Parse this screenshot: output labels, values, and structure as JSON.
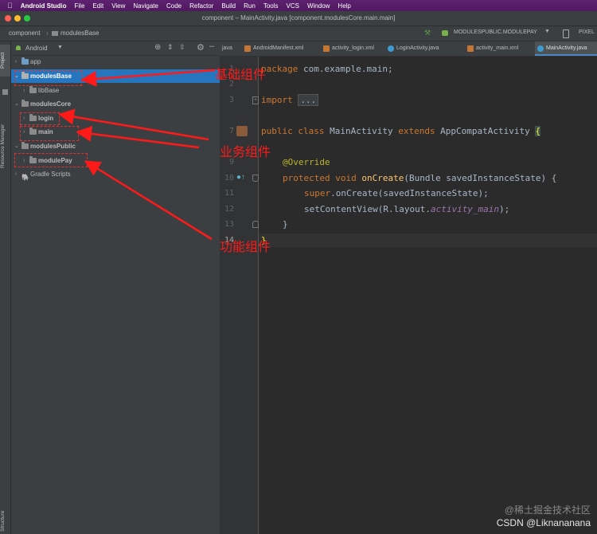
{
  "menubar": {
    "items": [
      "Android Studio",
      "File",
      "Edit",
      "View",
      "Navigate",
      "Code",
      "Refactor",
      "Build",
      "Run",
      "Tools",
      "VCS",
      "Window",
      "Help"
    ]
  },
  "titlebar": {
    "title": "component – MainActivity.java [component.modulesCore.main.main]"
  },
  "navbar": {
    "crumb1": "component",
    "crumb2": "modulesBase",
    "run_config": "MODULESPUBLIC.MODULEPAY",
    "device": "PIXEL"
  },
  "toolstrip": {
    "project": "Project",
    "resource_manager": "Resource Manager",
    "structure": "Structure"
  },
  "project_panel": {
    "view_mode": "Android",
    "tree": [
      {
        "label": "app",
        "expanded": false
      },
      {
        "label": "modulesBase",
        "expanded": true,
        "selected": true
      },
      {
        "label": "libBase",
        "expanded": false
      },
      {
        "label": "modulesCore",
        "expanded": true
      },
      {
        "label": "login",
        "expanded": false
      },
      {
        "label": "main",
        "expanded": false
      },
      {
        "label": "modulesPublic",
        "expanded": true
      },
      {
        "label": "modulePay",
        "expanded": false
      },
      {
        "label": "Gradle Scripts",
        "expanded": false
      }
    ]
  },
  "tabs": [
    {
      "label": "java"
    },
    {
      "label": "AndroidManifest.xml"
    },
    {
      "label": "activity_login.xml"
    },
    {
      "label": "LoginActivity.java"
    },
    {
      "label": "activity_main.xml"
    },
    {
      "label": "MainActivity.java",
      "active": true
    }
  ],
  "editor": {
    "line_numbers": [
      "1",
      "2",
      "3",
      "7",
      "9",
      "10",
      "11",
      "12",
      "13",
      "14"
    ],
    "code": {
      "l1_kw": "package",
      "l1_rest": " com.example.main;",
      "l3_kw": "import",
      "l3_fold": "...",
      "l7_kw1": "public class",
      "l7_name": " MainActivity ",
      "l7_kw2": "extends",
      "l7_rest": " AppCompatActivity ",
      "l7_brace": "{",
      "l9_ann": "@Override",
      "l10_kw": "protected void",
      "l10_fn": " onCreate",
      "l10_rest": "(Bundle savedInstanceState) {",
      "l11_kw": "super",
      "l11_rest": ".onCreate(savedInstanceState);",
      "l12_a": "setContentView(R.layout.",
      "l12_it": "activity_main",
      "l12_b": ");",
      "l13": "}",
      "l14": "}"
    }
  },
  "annotations": {
    "base": "基础组件",
    "business": "业务组件",
    "feature": "功能组件",
    "color": "#ff1a1a"
  },
  "watermark": {
    "line1": "@稀土掘金技术社区",
    "line2": "CSDN @Liknananana"
  }
}
